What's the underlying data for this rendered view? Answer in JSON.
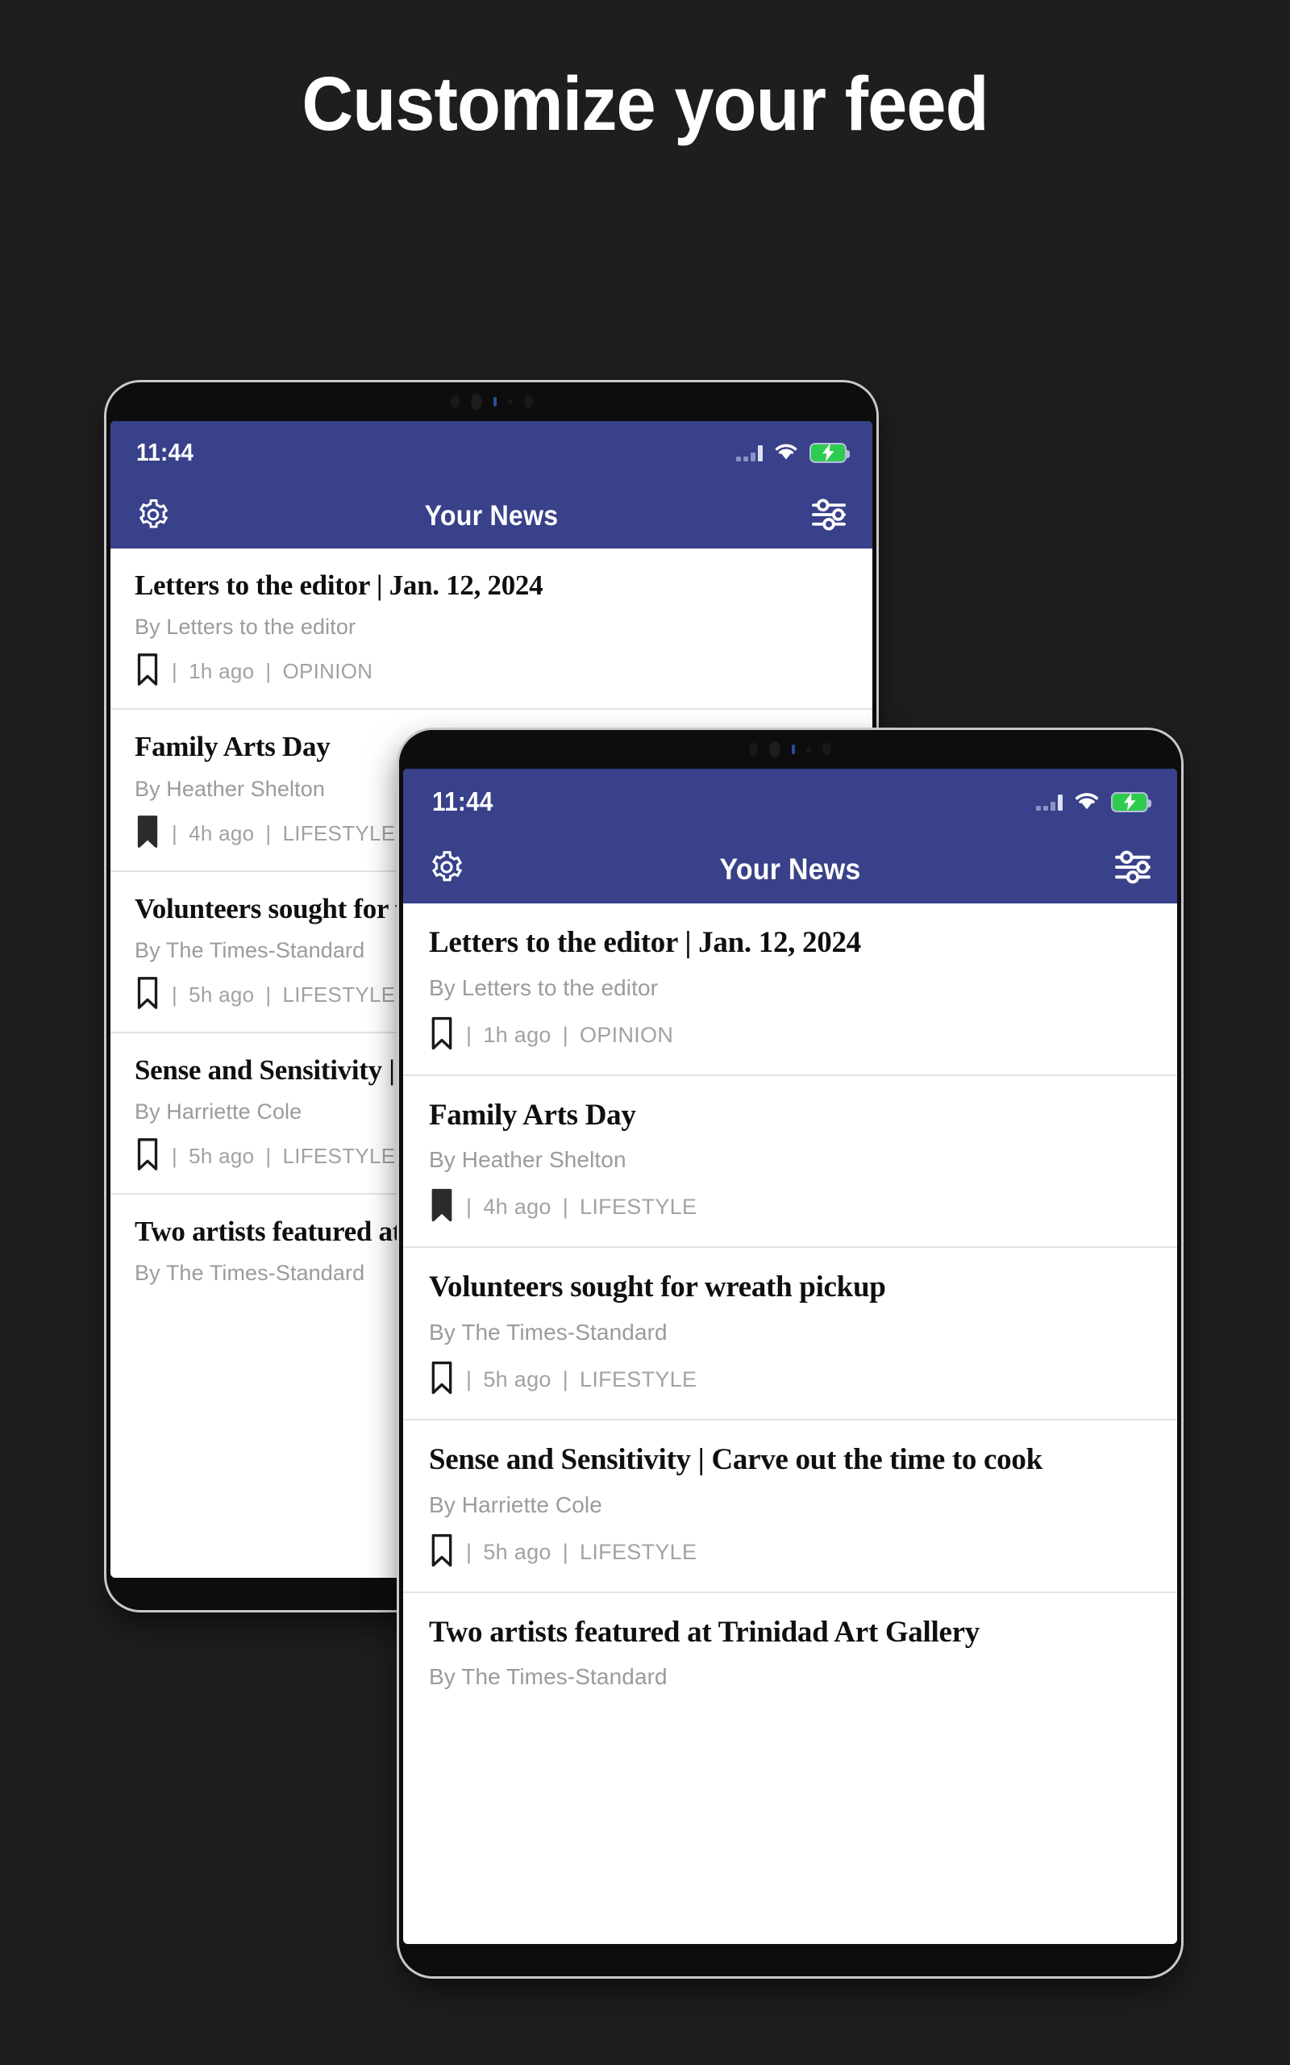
{
  "page": {
    "title": "Customize your feed",
    "background_color": "#1e1e1e",
    "accent_color": "#384189"
  },
  "status_bar": {
    "time": "11:44",
    "signal_icon": "cellular-signal-icon",
    "wifi_icon": "wifi-icon",
    "battery_icon": "battery-charging-icon",
    "battery_color": "#2dcc50"
  },
  "app_bar": {
    "title": "Your News",
    "settings_icon": "gear-icon",
    "filter_icon": "sliders-icon"
  },
  "articles": [
    {
      "headline": "Letters to the editor | Jan. 12, 2024",
      "byline": "By Letters to the editor",
      "bookmark": "bookmark-outline-icon",
      "saved": false,
      "separator1": "|",
      "time_ago": "1h ago",
      "separator2": "|",
      "category": "OPINION"
    },
    {
      "headline": "Family Arts Day",
      "byline": "By Heather Shelton",
      "bookmark": "bookmark-filled-icon",
      "saved": true,
      "separator1": "|",
      "time_ago": "4h ago",
      "separator2": "|",
      "category": "LIFESTYLE"
    },
    {
      "headline": "Volunteers sought for wreath pickup",
      "byline": "By The Times-Standard",
      "bookmark": "bookmark-outline-icon",
      "saved": false,
      "separator1": "|",
      "time_ago": "5h ago",
      "separator2": "|",
      "category": "LIFESTYLE"
    },
    {
      "headline": "Sense and Sensitivity | Carve out the time to cook",
      "byline": "By Harriette Cole",
      "bookmark": "bookmark-outline-icon",
      "saved": false,
      "separator1": "|",
      "time_ago": "5h ago",
      "separator2": "|",
      "category": "LIFESTYLE"
    },
    {
      "headline": "Two artists featured at Trinidad Art Gallery",
      "byline": "By The Times-Standard",
      "bookmark": "",
      "saved": false,
      "separator1": "",
      "time_ago": "",
      "separator2": "",
      "category": ""
    }
  ]
}
